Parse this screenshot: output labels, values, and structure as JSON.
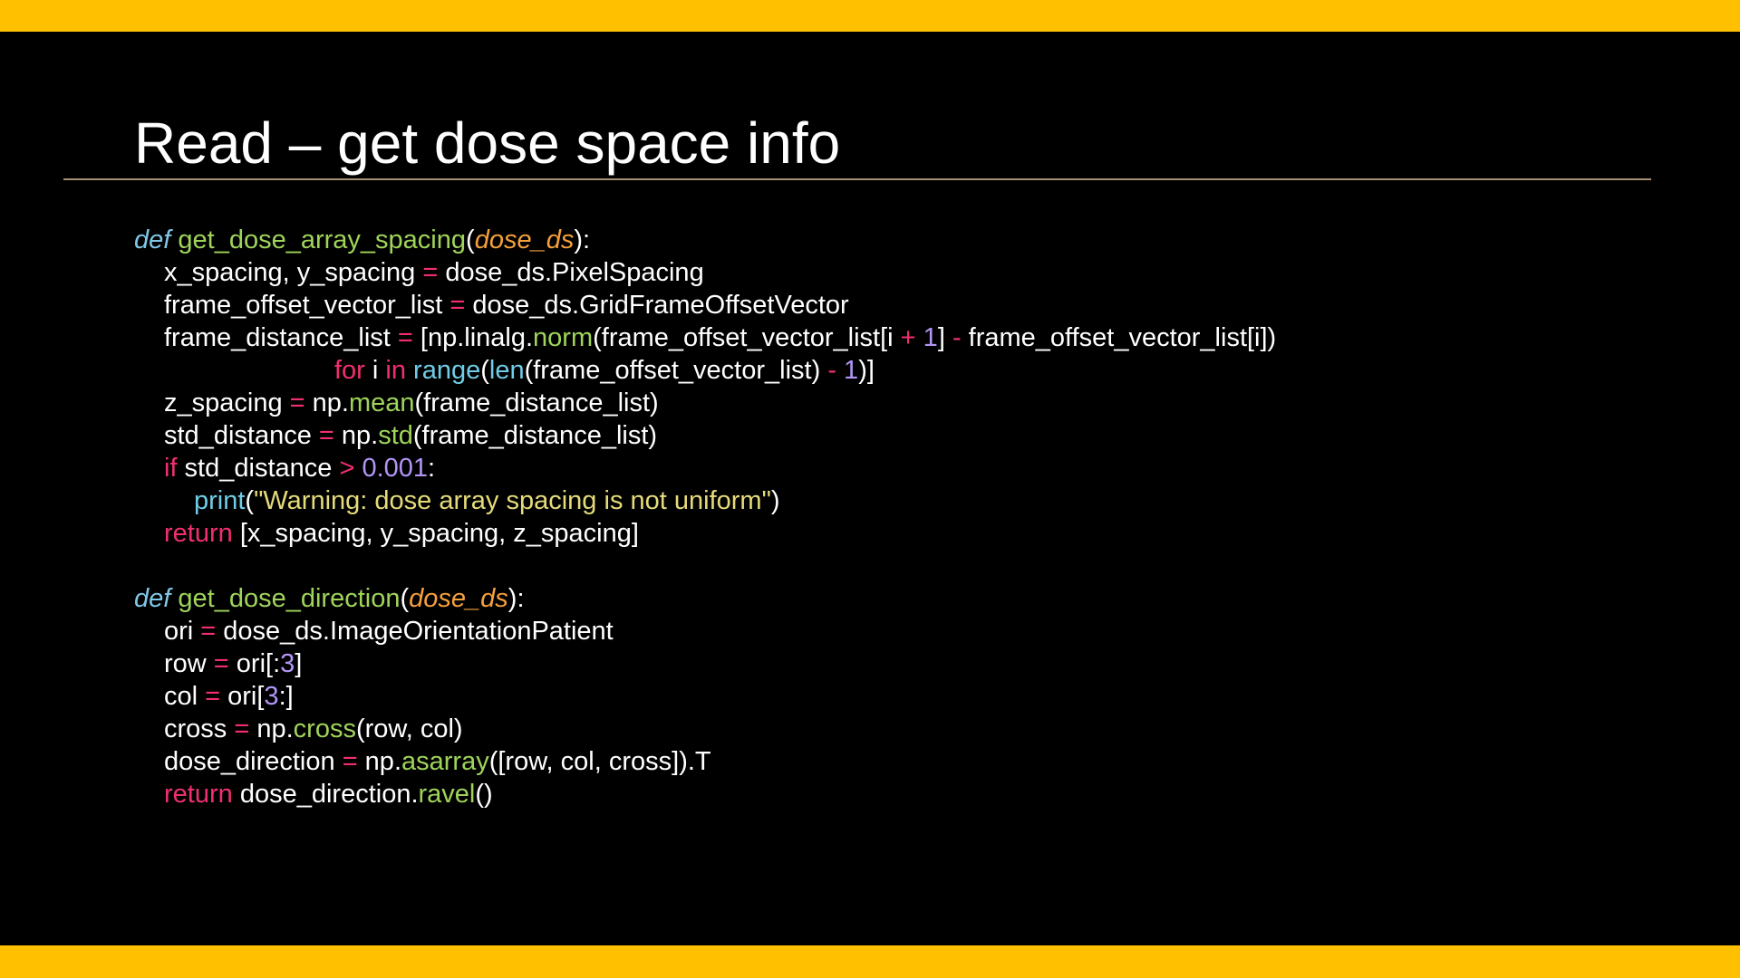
{
  "slide": {
    "title": "Read – get dose space info",
    "colors": {
      "accent_bar": "#FFC000",
      "background": "#000000",
      "rule": "#A88E74"
    }
  },
  "code_lines": [
    {
      "indent": 0,
      "tokens": [
        {
          "t": "def",
          "c": "def"
        },
        {
          "t": " ",
          "c": "plain"
        },
        {
          "t": "get_dose_array_spacing",
          "c": "fn"
        },
        {
          "t": "(",
          "c": "plain"
        },
        {
          "t": "dose_ds",
          "c": "param"
        },
        {
          "t": "):",
          "c": "plain"
        }
      ]
    },
    {
      "indent": 1,
      "tokens": [
        {
          "t": "x_spacing, y_spacing ",
          "c": "plain"
        },
        {
          "t": "=",
          "c": "op"
        },
        {
          "t": " dose_ds.PixelSpacing",
          "c": "plain"
        }
      ]
    },
    {
      "indent": 1,
      "tokens": [
        {
          "t": "frame_offset_vector_list ",
          "c": "plain"
        },
        {
          "t": "=",
          "c": "op"
        },
        {
          "t": " dose_ds.GridFrameOffsetVector",
          "c": "plain"
        }
      ]
    },
    {
      "indent": 1,
      "tokens": [
        {
          "t": "frame_distance_list ",
          "c": "plain"
        },
        {
          "t": "=",
          "c": "op"
        },
        {
          "t": " [np.linalg.",
          "c": "plain"
        },
        {
          "t": "norm",
          "c": "method"
        },
        {
          "t": "(frame_offset_vector_list[i ",
          "c": "plain"
        },
        {
          "t": "+",
          "c": "op"
        },
        {
          "t": " ",
          "c": "plain"
        },
        {
          "t": "1",
          "c": "num"
        },
        {
          "t": "] ",
          "c": "plain"
        },
        {
          "t": "-",
          "c": "op"
        },
        {
          "t": " frame_offset_vector_list[i])",
          "c": "plain"
        }
      ]
    },
    {
      "indent": 6.7,
      "tokens": [
        {
          "t": "for",
          "c": "kw"
        },
        {
          "t": " i ",
          "c": "plain"
        },
        {
          "t": "in",
          "c": "kw"
        },
        {
          "t": " ",
          "c": "plain"
        },
        {
          "t": "range",
          "c": "builtin"
        },
        {
          "t": "(",
          "c": "plain"
        },
        {
          "t": "len",
          "c": "builtin"
        },
        {
          "t": "(frame_offset_vector_list) ",
          "c": "plain"
        },
        {
          "t": "-",
          "c": "op"
        },
        {
          "t": " ",
          "c": "plain"
        },
        {
          "t": "1",
          "c": "num"
        },
        {
          "t": ")]",
          "c": "plain"
        }
      ]
    },
    {
      "indent": 1,
      "tokens": [
        {
          "t": "z_spacing ",
          "c": "plain"
        },
        {
          "t": "=",
          "c": "op"
        },
        {
          "t": " np.",
          "c": "plain"
        },
        {
          "t": "mean",
          "c": "method"
        },
        {
          "t": "(frame_distance_list)",
          "c": "plain"
        }
      ]
    },
    {
      "indent": 1,
      "tokens": [
        {
          "t": "std_distance ",
          "c": "plain"
        },
        {
          "t": "=",
          "c": "op"
        },
        {
          "t": " np.",
          "c": "plain"
        },
        {
          "t": "std",
          "c": "method"
        },
        {
          "t": "(frame_distance_list)",
          "c": "plain"
        }
      ]
    },
    {
      "indent": 1,
      "tokens": [
        {
          "t": "if",
          "c": "kw"
        },
        {
          "t": " std_distance ",
          "c": "plain"
        },
        {
          "t": ">",
          "c": "op"
        },
        {
          "t": " ",
          "c": "plain"
        },
        {
          "t": "0.001",
          "c": "num"
        },
        {
          "t": ":",
          "c": "plain"
        }
      ]
    },
    {
      "indent": 2,
      "tokens": [
        {
          "t": "print",
          "c": "builtin"
        },
        {
          "t": "(",
          "c": "plain"
        },
        {
          "t": "\"Warning: dose array spacing is not uniform\"",
          "c": "str"
        },
        {
          "t": ")",
          "c": "plain"
        }
      ]
    },
    {
      "indent": 1,
      "tokens": [
        {
          "t": "return",
          "c": "kw"
        },
        {
          "t": " [x_spacing, y_spacing, z_spacing]",
          "c": "plain"
        }
      ]
    },
    {
      "indent": 0,
      "tokens": []
    },
    {
      "indent": 0,
      "tokens": [
        {
          "t": "def",
          "c": "def"
        },
        {
          "t": " ",
          "c": "plain"
        },
        {
          "t": "get_dose_direction",
          "c": "fn"
        },
        {
          "t": "(",
          "c": "plain"
        },
        {
          "t": "dose_ds",
          "c": "param"
        },
        {
          "t": "):",
          "c": "plain"
        }
      ]
    },
    {
      "indent": 1,
      "tokens": [
        {
          "t": "ori ",
          "c": "plain"
        },
        {
          "t": "=",
          "c": "op"
        },
        {
          "t": " dose_ds.ImageOrientationPatient",
          "c": "plain"
        }
      ]
    },
    {
      "indent": 1,
      "tokens": [
        {
          "t": "row ",
          "c": "plain"
        },
        {
          "t": "=",
          "c": "op"
        },
        {
          "t": " ori[:",
          "c": "plain"
        },
        {
          "t": "3",
          "c": "num"
        },
        {
          "t": "]",
          "c": "plain"
        }
      ]
    },
    {
      "indent": 1,
      "tokens": [
        {
          "t": "col ",
          "c": "plain"
        },
        {
          "t": "=",
          "c": "op"
        },
        {
          "t": " ori[",
          "c": "plain"
        },
        {
          "t": "3",
          "c": "num"
        },
        {
          "t": ":]",
          "c": "plain"
        }
      ]
    },
    {
      "indent": 1,
      "tokens": [
        {
          "t": "cross ",
          "c": "plain"
        },
        {
          "t": "=",
          "c": "op"
        },
        {
          "t": " np.",
          "c": "plain"
        },
        {
          "t": "cross",
          "c": "method"
        },
        {
          "t": "(row, col)",
          "c": "plain"
        }
      ]
    },
    {
      "indent": 1,
      "tokens": [
        {
          "t": "dose_direction ",
          "c": "plain"
        },
        {
          "t": "=",
          "c": "op"
        },
        {
          "t": " np.",
          "c": "plain"
        },
        {
          "t": "asarray",
          "c": "method"
        },
        {
          "t": "([row, col, cross]).T",
          "c": "plain"
        }
      ]
    },
    {
      "indent": 1,
      "tokens": [
        {
          "t": "return",
          "c": "kw"
        },
        {
          "t": " dose_direction.",
          "c": "plain"
        },
        {
          "t": "ravel",
          "c": "method"
        },
        {
          "t": "()",
          "c": "plain"
        }
      ]
    }
  ]
}
